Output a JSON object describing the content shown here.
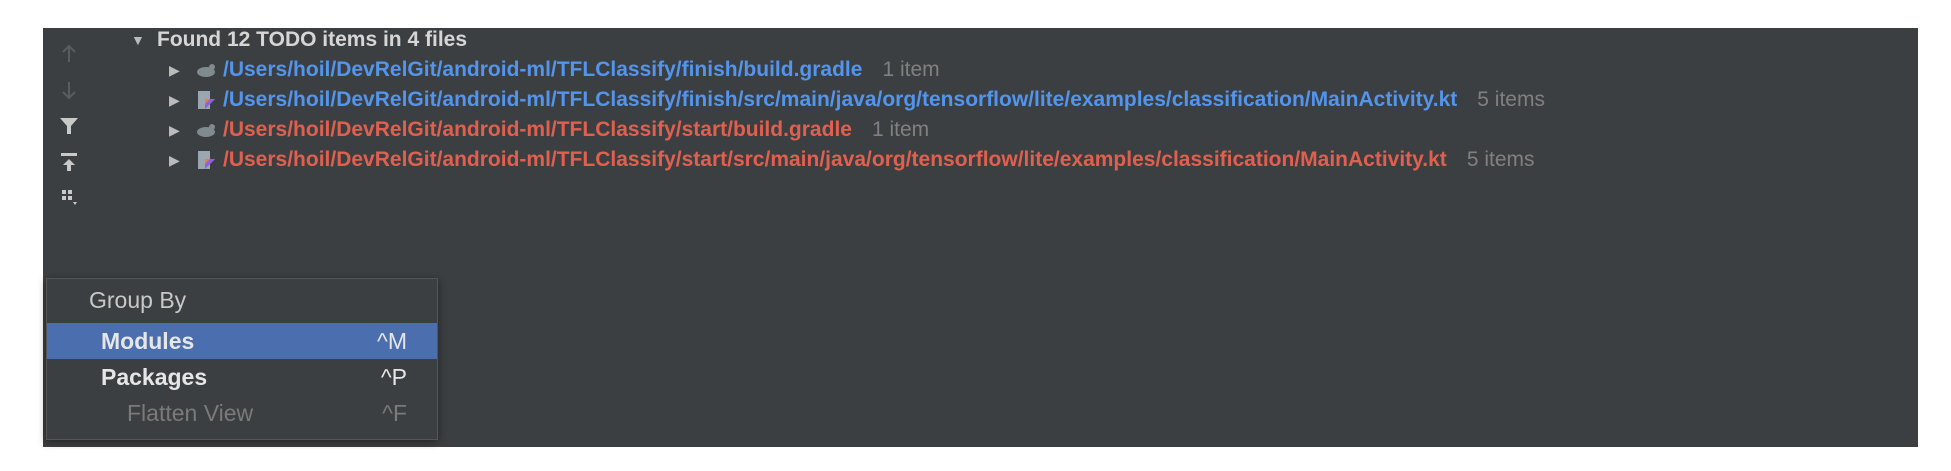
{
  "colors": {
    "panel_bg": "#3c3f41",
    "path_finish": "#5394ec",
    "path_start": "#e0604f",
    "count_text": "#808080",
    "selection_bg": "#4b6eaf"
  },
  "toolbar": {
    "items": [
      {
        "icon": "arrow-up-icon"
      },
      {
        "icon": "arrow-down-icon"
      },
      {
        "icon": "filter-icon"
      },
      {
        "icon": "preview-icon"
      },
      {
        "icon": "group-by-icon"
      }
    ]
  },
  "tree": {
    "root_label": "Found 12 TODO items in 4 files",
    "files": [
      {
        "icon": "gradle-icon",
        "path": "/Users/hoil/DevRelGit/android-ml/TFLClassify/finish/build.gradle",
        "count": "1 item",
        "color": "blue"
      },
      {
        "icon": "kotlin-file-icon",
        "path": "/Users/hoil/DevRelGit/android-ml/TFLClassify/finish/src/main/java/org/tensorflow/lite/examples/classification/MainActivity.kt",
        "count": "5 items",
        "color": "blue"
      },
      {
        "icon": "gradle-icon",
        "path": "/Users/hoil/DevRelGit/android-ml/TFLClassify/start/build.gradle",
        "count": "1 item",
        "color": "red"
      },
      {
        "icon": "kotlin-file-icon",
        "path": "/Users/hoil/DevRelGit/android-ml/TFLClassify/start/src/main/java/org/tensorflow/lite/examples/classification/MainActivity.kt",
        "count": "5 items",
        "color": "red"
      }
    ]
  },
  "group_by_menu": {
    "title": "Group By",
    "items": [
      {
        "label": "Modules",
        "shortcut": "^M",
        "selected": true,
        "checked": true,
        "enabled": true
      },
      {
        "label": "Packages",
        "shortcut": "^P",
        "selected": false,
        "checked": true,
        "enabled": true
      },
      {
        "label": "Flatten View",
        "shortcut": "^F",
        "selected": false,
        "checked": false,
        "enabled": false
      }
    ]
  }
}
